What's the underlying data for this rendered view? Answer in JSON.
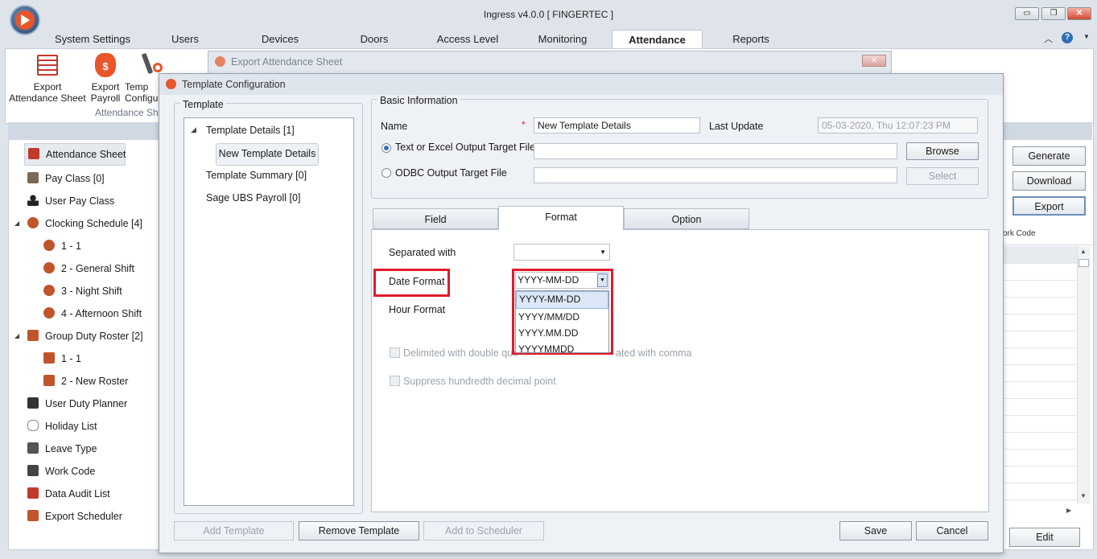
{
  "app": {
    "title": "Ingress v4.0.0 [ FINGERTEC ]"
  },
  "menu": [
    "System Settings",
    "Users",
    "Devices",
    "Doors",
    "Access Level",
    "Monitoring",
    "Attendance",
    "Reports"
  ],
  "ribbon": {
    "export_attendance_sheet": "Export\nAttendance Sheet",
    "export_payroll": "Export\nPayroll",
    "template_config": "Temp\nConfigu",
    "group_label": "Attendance Sh"
  },
  "left_nav": {
    "items": [
      {
        "label": "Attendance Sheet",
        "icon": "sheet-icon"
      },
      {
        "label": "Pay Class [0]",
        "icon": "money-bag-icon"
      },
      {
        "label": "User Pay Class",
        "icon": "user-icon"
      },
      {
        "label": "Clocking Schedule [4]",
        "icon": "clock-icon"
      },
      {
        "label": "1 - 1",
        "icon": "clock-icon"
      },
      {
        "label": "2 - General Shift",
        "icon": "clock-icon"
      },
      {
        "label": "3 - Night Shift",
        "icon": "clock-icon"
      },
      {
        "label": "4 - Afternoon Shift",
        "icon": "clock-icon"
      },
      {
        "label": "Group Duty Roster [2]",
        "icon": "roster-icon"
      },
      {
        "label": "1 - 1",
        "icon": "roster-icon"
      },
      {
        "label": "2 - New Roster",
        "icon": "roster-icon"
      },
      {
        "label": "User Duty Planner",
        "icon": "briefcase-icon"
      },
      {
        "label": "Holiday List",
        "icon": "sandals-icon"
      },
      {
        "label": "Leave Type",
        "icon": "grid-icon"
      },
      {
        "label": "Work Code",
        "icon": "monitor-icon"
      },
      {
        "label": "Data Audit List",
        "icon": "list-icon"
      },
      {
        "label": "Export Scheduler",
        "icon": "scheduler-icon"
      }
    ]
  },
  "right_pane": {
    "generate": "Generate",
    "download": "Download",
    "export": "Export",
    "column_header": "ork Code",
    "edit": "Edit"
  },
  "export_dialog": {
    "title": "Export Attendance Sheet"
  },
  "template_dialog": {
    "title": "Template Configuration",
    "template_group": "Template",
    "tree": {
      "details": "Template Details [1]",
      "new_details": "New Template Details",
      "summary": "Template Summary [0]",
      "sage": "Sage UBS Payroll [0]"
    },
    "basic_info": {
      "group": "Basic Information",
      "name_label": "Name",
      "required": "*",
      "name_value": "New Template Details",
      "last_update_label": "Last Update",
      "last_update_value": "05-03-2020, Thu  12:07:23 PM",
      "text_excel_label": "Text or Excel Output Target File",
      "odbc_label": "ODBC Output Target File",
      "browse": "Browse",
      "select": "Select"
    },
    "tabs": [
      "Field",
      "Format",
      "Option"
    ],
    "format": {
      "separated_with": "Separated with",
      "date_format": "Date Format",
      "date_format_value": "YYYY-MM-DD",
      "date_options": [
        "YYYY-MM-DD",
        "YYYY/MM/DD",
        "YYYY.MM.DD",
        "YYYYMMDD"
      ],
      "hour_format": "Hour Format",
      "delimited_left": "Delimited with double quo",
      "delimited_right": "ated with comma",
      "suppress": "Suppress hundredth decimal point"
    },
    "buttons": {
      "add_template": "Add Template",
      "remove_template": "Remove Template",
      "add_scheduler": "Add to Scheduler",
      "save": "Save",
      "cancel": "Cancel"
    }
  },
  "colors": {
    "accent_red": "#e11a2c",
    "brand_orange": "#e8562a"
  }
}
